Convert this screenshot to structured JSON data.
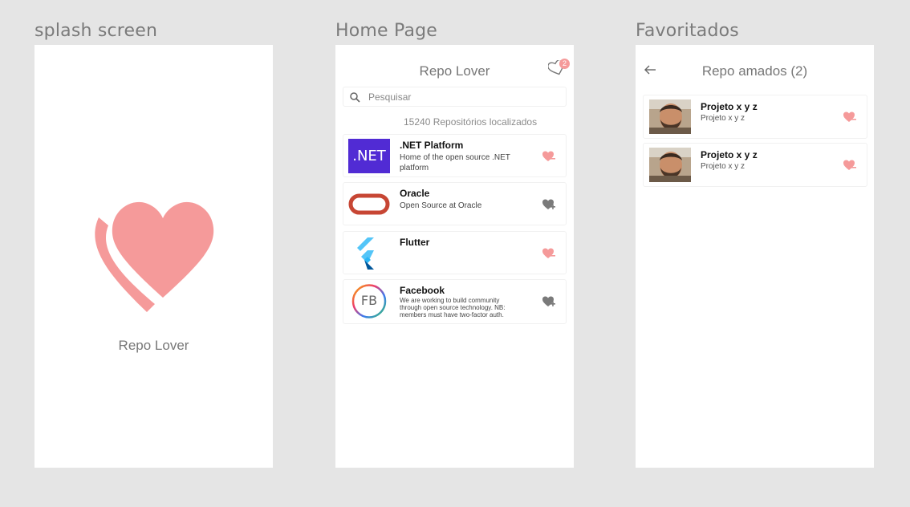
{
  "frames": {
    "splash": {
      "label": "splash screen",
      "app_title": "Repo Lover"
    },
    "home": {
      "label": "Home Page"
    },
    "favorites": {
      "label": "Favoritados"
    }
  },
  "home": {
    "title": "Repo Lover",
    "favorites_count_badge": "2",
    "search": {
      "placeholder": "Pesquisar",
      "value": ""
    },
    "results_count": "15240 Repositórios localizados",
    "repos": [
      {
        "name": ".NET Platform",
        "description": "Home of the open source .NET platform",
        "logo_text": ".NET",
        "logo": "dotnet-logo",
        "favorited": true
      },
      {
        "name": "Oracle",
        "description": "Open Source at Oracle",
        "logo": "oracle-logo",
        "favorited": false
      },
      {
        "name": "Flutter",
        "description": "",
        "logo": "flutter-logo",
        "favorited": true
      },
      {
        "name": "Facebook",
        "description": "We are working to build community through open source technology. NB: members must have two-factor auth.",
        "logo_text": "FB",
        "logo": "facebook-logo",
        "favorited": false
      }
    ]
  },
  "favorites": {
    "title": "Repo amados (2)",
    "items": [
      {
        "name": "Projeto x y z",
        "description": "Projeto x y z"
      },
      {
        "name": "Projeto x y z",
        "description": "Projeto x y z"
      }
    ]
  },
  "colors": {
    "accent": "#f59a9a",
    "background": "#e5e5e5",
    "heart_inactive": "#7a7a7a",
    "dotnet": "#512bd4",
    "oracle": "#c74634"
  }
}
